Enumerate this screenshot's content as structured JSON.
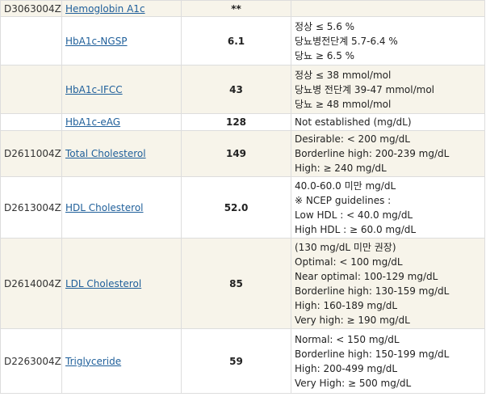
{
  "rows": [
    {
      "code": "D3063004Z",
      "name": "Hemoglobin A1c",
      "value": "**",
      "ref": [],
      "shade": true
    },
    {
      "code": "",
      "name": "HbA1c-NGSP",
      "value": "6.1",
      "ref": [
        "정상 ≤ 5.6 %",
        "당뇨병전단계 5.7-6.4 %",
        "당뇨 ≥ 6.5 %"
      ],
      "shade": false
    },
    {
      "code": "",
      "name": "HbA1c-IFCC",
      "value": "43",
      "ref": [
        "정상 ≤ 38 mmol/mol",
        "당뇨병 전단계 39-47 mmol/mol",
        "당뇨 ≥ 48 mmol/mol"
      ],
      "shade": true
    },
    {
      "code": "",
      "name": "HbA1c-eAG",
      "value": "128",
      "ref": [
        "Not established (mg/dL)"
      ],
      "shade": false
    },
    {
      "code": "D2611004Z",
      "name": "Total Cholesterol",
      "value": "149",
      "ref": [
        "Desirable: < 200 mg/dL",
        "Borderline high: 200-239 mg/dL",
        "High: ≥ 240 mg/dL"
      ],
      "shade": true
    },
    {
      "code": "D2613004Z",
      "name": "HDL Cholesterol",
      "value": "52.0",
      "ref": [
        "40.0-60.0 미만 mg/dL",
        "※ NCEP guidelines :",
        "Low HDL : < 40.0 mg/dL",
        "High HDL : ≥ 60.0 mg/dL"
      ],
      "shade": false
    },
    {
      "code": "D2614004Z",
      "name": "LDL Cholesterol",
      "value": "85",
      "ref": [
        "(130 mg/dL 미만 권장)",
        "Optimal: < 100 mg/dL",
        "Near optimal: 100-129 mg/dL",
        "Borderline high: 130-159 mg/dL",
        "High: 160-189 mg/dL",
        "Very high: ≥ 190 mg/dL"
      ],
      "shade": true
    },
    {
      "code": "D2263004Z",
      "name": "Triglyceride",
      "value": "59",
      "ref": [
        "Normal: < 150 mg/dL",
        "Borderline high: 150-199 mg/dL",
        "High: 200-499 mg/dL",
        "Very High: ≥ 500 mg/dL"
      ],
      "shade": false
    }
  ]
}
